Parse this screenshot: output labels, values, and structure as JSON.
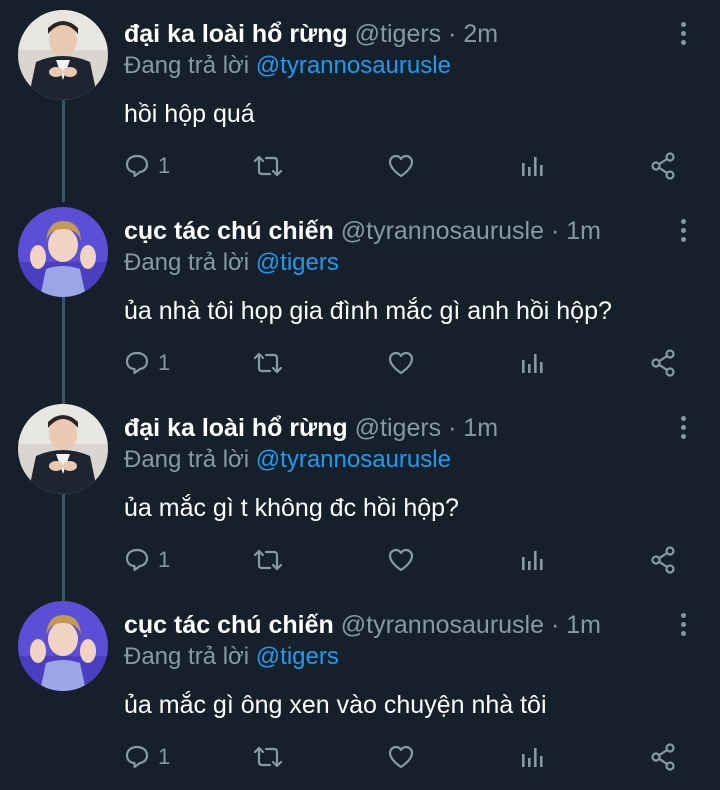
{
  "tweets": [
    {
      "name": "đại ka loài hổ rừng",
      "handle": "@tigers",
      "separator": "·",
      "time": "2m",
      "reply_prefix": "Đang trả lời",
      "reply_to": "@tyrannosaurusle",
      "text": "hồi hộp quá",
      "reply_count": "1",
      "avatar_icon": "avatar-tigers"
    },
    {
      "name": "cục tác chú chiến",
      "handle": "@tyrannosaurusle",
      "separator": "·",
      "time": "1m",
      "reply_prefix": "Đang trả lời",
      "reply_to": "@tigers",
      "text": "ủa nhà tôi họp gia đình mắc gì anh hồi hộp?",
      "reply_count": "1",
      "avatar_icon": "avatar-tyrannosaurusle"
    },
    {
      "name": "đại ka loài hổ rừng",
      "handle": "@tigers",
      "separator": "·",
      "time": "1m",
      "reply_prefix": "Đang trả lời",
      "reply_to": "@tyrannosaurusle",
      "text": "ủa mắc gì t không đc hồi hộp?",
      "reply_count": "1",
      "avatar_icon": "avatar-tigers"
    },
    {
      "name": "cục tác chú chiến",
      "handle": "@tyrannosaurusle",
      "separator": "·",
      "time": "1m",
      "reply_prefix": "Đang trả lời",
      "reply_to": "@tigers",
      "text": "ủa mắc gì ông xen vào chuyện nhà tôi",
      "reply_count": "1",
      "avatar_icon": "avatar-tyrannosaurusle"
    }
  ],
  "icons": {
    "reply": "reply-icon",
    "retweet": "retweet-icon",
    "like": "like-icon",
    "analytics": "analytics-icon",
    "share": "share-icon",
    "more": "more-options-icon"
  },
  "colors": {
    "background": "#15202b",
    "text": "#ffffff",
    "muted": "#8899a6",
    "link": "#1d9bf0",
    "thread_line": "#3d5466",
    "avatar_purple": "#5b4fd6"
  }
}
